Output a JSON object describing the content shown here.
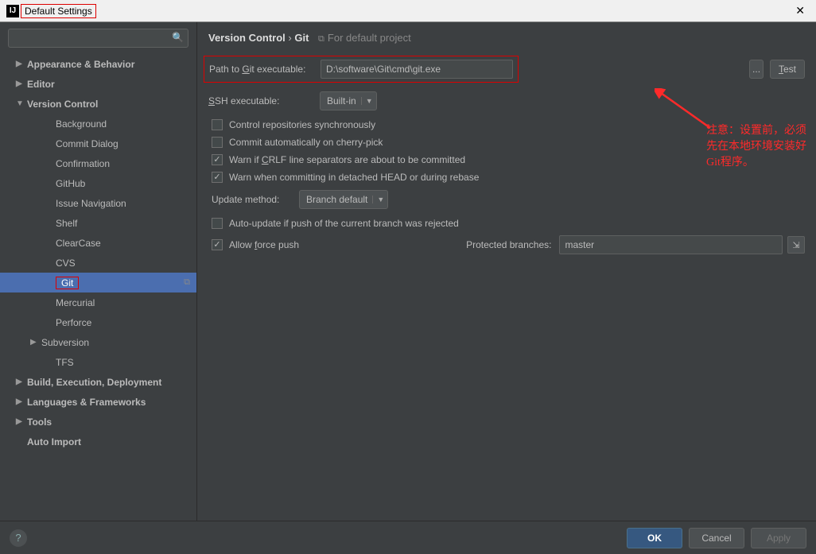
{
  "window": {
    "title": "Default Settings"
  },
  "sidebar": {
    "search_placeholder": "",
    "items": [
      {
        "label": "Appearance & Behavior",
        "arrow": "▶",
        "bold": true
      },
      {
        "label": "Editor",
        "arrow": "▶",
        "bold": true
      },
      {
        "label": "Version Control",
        "arrow": "▼",
        "bold": true
      },
      {
        "label": "Background"
      },
      {
        "label": "Commit Dialog"
      },
      {
        "label": "Confirmation"
      },
      {
        "label": "GitHub"
      },
      {
        "label": "Issue Navigation"
      },
      {
        "label": "Shelf"
      },
      {
        "label": "ClearCase"
      },
      {
        "label": "CVS"
      },
      {
        "label": "Git",
        "selected": true
      },
      {
        "label": "Mercurial"
      },
      {
        "label": "Perforce"
      },
      {
        "label": "Subversion",
        "arrow": "▶"
      },
      {
        "label": "TFS"
      },
      {
        "label": "Build, Execution, Deployment",
        "arrow": "▶",
        "bold": true
      },
      {
        "label": "Languages & Frameworks",
        "arrow": "▶",
        "bold": true
      },
      {
        "label": "Tools",
        "arrow": "▶",
        "bold": true
      },
      {
        "label": "Auto Import",
        "bold": true
      }
    ]
  },
  "breadcrumb": {
    "a": "Version Control",
    "b": "Git",
    "proj": "For default project"
  },
  "form": {
    "git_path_label_pre": "Path to ",
    "git_path_label_ul": "G",
    "git_path_label_post": "it executable:",
    "git_path_value": "D:\\software\\Git\\cmd\\git.exe",
    "ellipsis": "...",
    "test_ul": "T",
    "test_post": "est",
    "ssh_label_ul": "S",
    "ssh_label_post": "SH executable:",
    "ssh_value": "Built-in",
    "update_label": "Update method:",
    "update_value": "Branch default",
    "checks": {
      "c1": "Control repositories synchronously",
      "c2": "Commit automatically on cherry-pick",
      "c3_pre": "Warn if ",
      "c3_ul": "C",
      "c3_post": "RLF line separators are about to be committed",
      "c4": "Warn when committing in detached HEAD or during rebase",
      "c5": "Auto-update if push of the current branch was rejected",
      "c6_pre": "Allow ",
      "c6_ul": "f",
      "c6_post": "orce push"
    },
    "protected_label": "Protected branches:",
    "protected_value": "master"
  },
  "annotation": "注意：设置前，必须先在本地环境安装好Git程序。",
  "footer": {
    "ok": "OK",
    "cancel": "Cancel",
    "apply": "Apply"
  }
}
